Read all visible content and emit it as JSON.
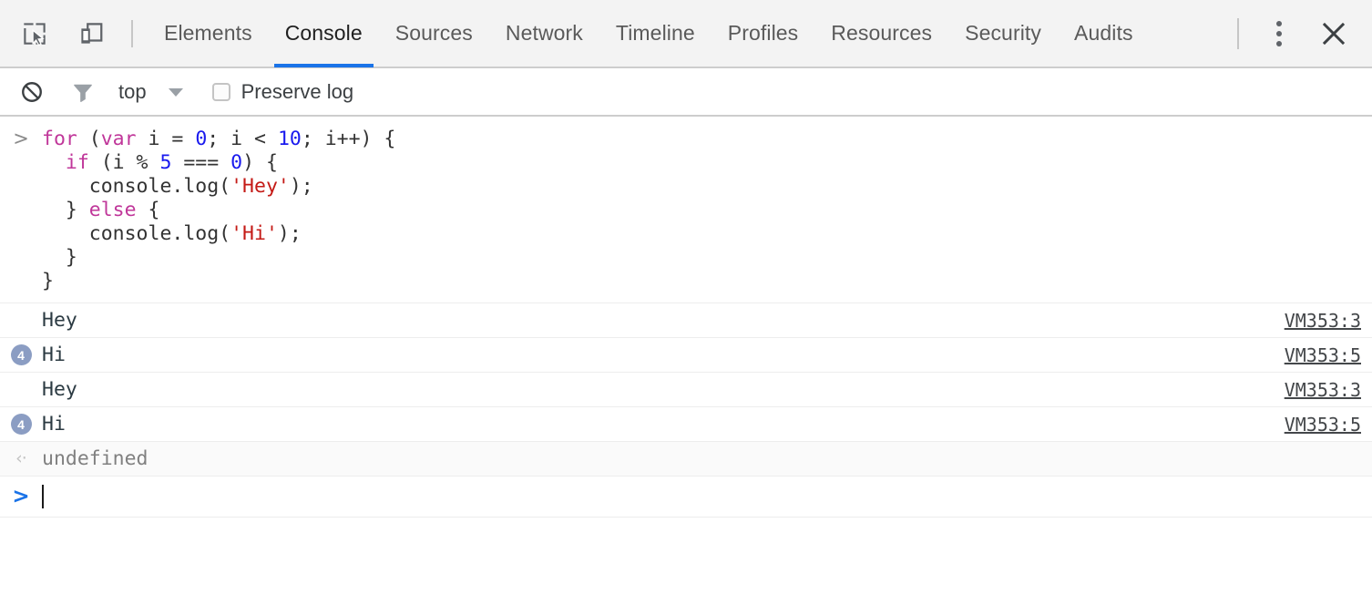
{
  "window": {
    "app": "Chrome DevTools"
  },
  "toolbar_icons": {
    "inspect": "inspect-element-icon",
    "device": "toggle-device-toolbar-icon",
    "kebab": "more-options-icon",
    "close": "close-icon"
  },
  "tabs": [
    {
      "label": "Elements",
      "active": false
    },
    {
      "label": "Console",
      "active": true
    },
    {
      "label": "Sources",
      "active": false
    },
    {
      "label": "Network",
      "active": false
    },
    {
      "label": "Timeline",
      "active": false
    },
    {
      "label": "Profiles",
      "active": false
    },
    {
      "label": "Resources",
      "active": false
    },
    {
      "label": "Security",
      "active": false
    },
    {
      "label": "Audits",
      "active": false
    }
  ],
  "filterbar": {
    "clear_icon": "clear-console-icon",
    "filter_icon": "filter-funnel-icon",
    "context": "top",
    "caret_icon": "chevron-down-icon",
    "preserve_log_label": "Preserve log",
    "preserve_log_checked": false
  },
  "input": {
    "prompt_glyph": ">",
    "lines": [
      [
        {
          "t": "kw",
          "s": "for"
        },
        {
          "t": "plain",
          "s": " ("
        },
        {
          "t": "kw",
          "s": "var"
        },
        {
          "t": "plain",
          "s": " i = "
        },
        {
          "t": "num",
          "s": "0"
        },
        {
          "t": "plain",
          "s": "; i < "
        },
        {
          "t": "num",
          "s": "10"
        },
        {
          "t": "plain",
          "s": "; i++) {"
        }
      ],
      [
        {
          "t": "plain",
          "s": "  "
        },
        {
          "t": "kw",
          "s": "if"
        },
        {
          "t": "plain",
          "s": " (i % "
        },
        {
          "t": "num",
          "s": "5"
        },
        {
          "t": "plain",
          "s": " === "
        },
        {
          "t": "num",
          "s": "0"
        },
        {
          "t": "plain",
          "s": ") {"
        }
      ],
      [
        {
          "t": "plain",
          "s": "    console.log("
        },
        {
          "t": "str",
          "s": "'Hey'"
        },
        {
          "t": "plain",
          "s": ");"
        }
      ],
      [
        {
          "t": "plain",
          "s": "  } "
        },
        {
          "t": "kw",
          "s": "else"
        },
        {
          "t": "plain",
          "s": " {"
        }
      ],
      [
        {
          "t": "plain",
          "s": "    console.log("
        },
        {
          "t": "str",
          "s": "'Hi'"
        },
        {
          "t": "plain",
          "s": ");"
        }
      ],
      [
        {
          "t": "plain",
          "s": "  }"
        }
      ],
      [
        {
          "t": "plain",
          "s": "}"
        }
      ]
    ]
  },
  "output_rows": [
    {
      "count": "",
      "message": "Hey",
      "source": "VM353:3"
    },
    {
      "count": "4",
      "message": "Hi",
      "source": "VM353:5"
    },
    {
      "count": "",
      "message": "Hey",
      "source": "VM353:3"
    },
    {
      "count": "4",
      "message": "Hi",
      "source": "VM353:5"
    }
  ],
  "result": {
    "glyph": "‹·",
    "value": "undefined"
  },
  "prompt": {
    "glyph": ">",
    "value": ""
  },
  "colors": {
    "accent_blue": "#1a73e8",
    "keyword": "#c0379a",
    "number": "#1a1aee",
    "string": "#c41a16",
    "badge_bg": "#8b9dc3",
    "tabbar_bg": "#f3f3f3"
  }
}
